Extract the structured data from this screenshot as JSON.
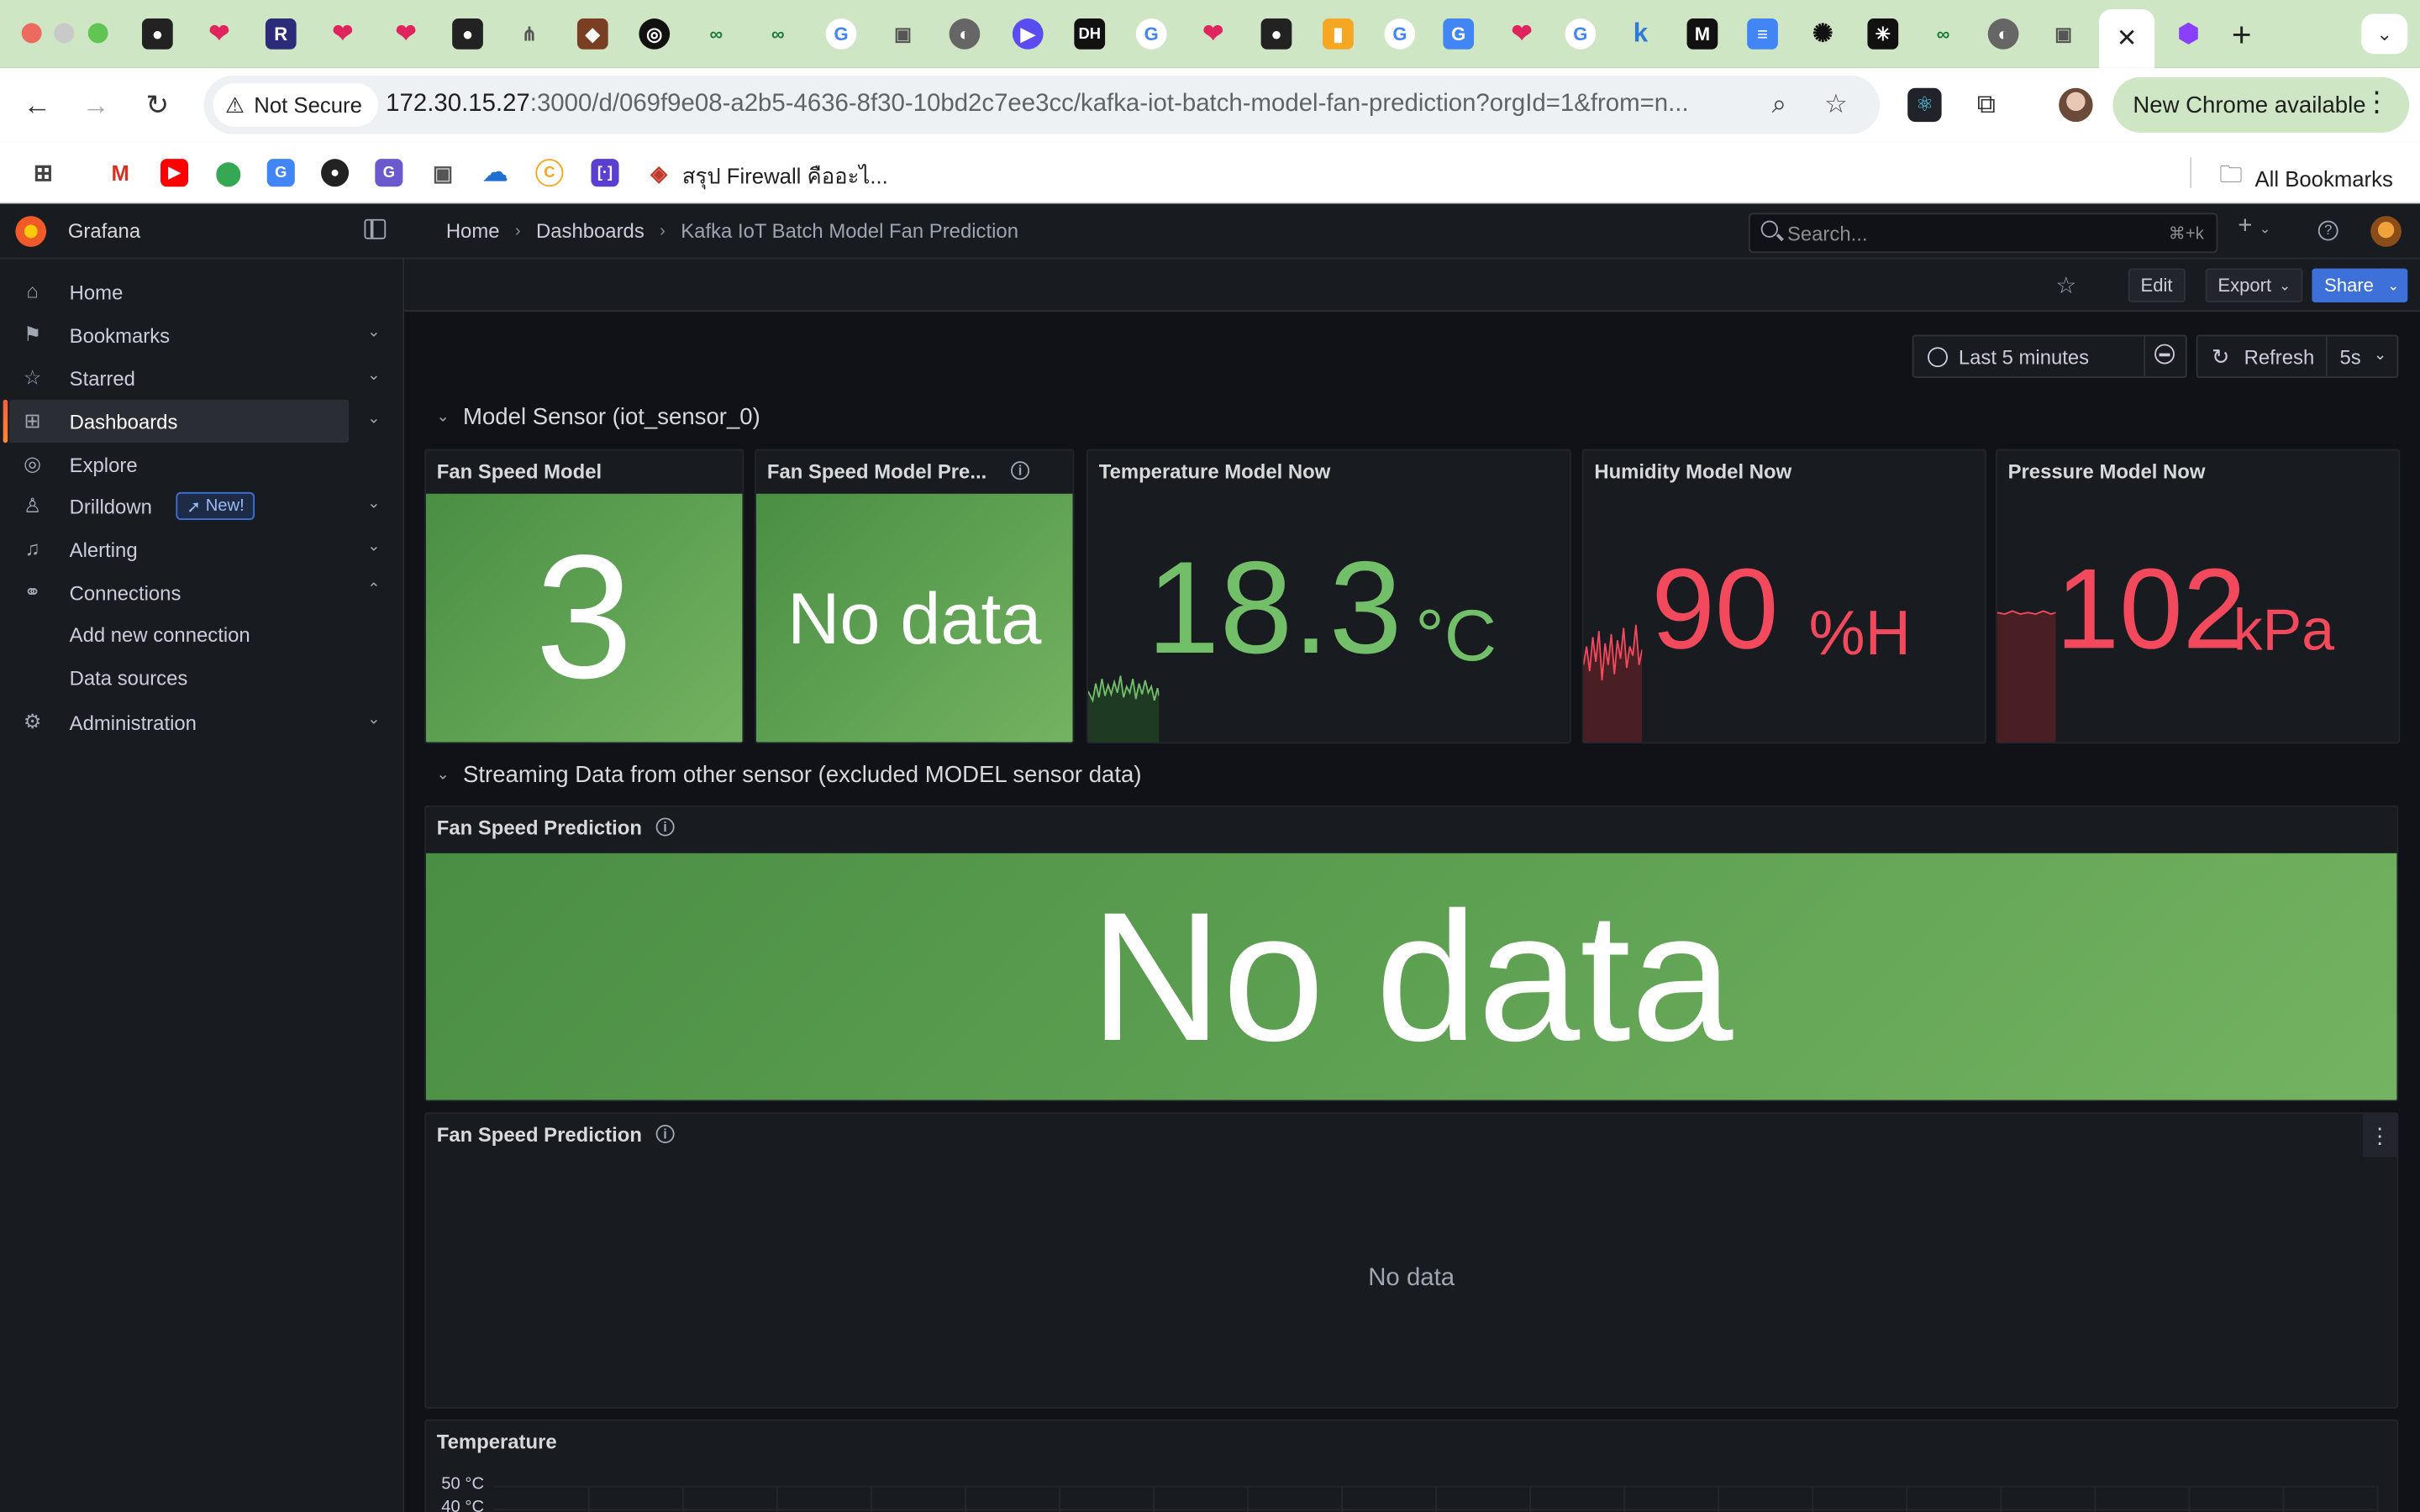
{
  "browser": {
    "url_host": "172.30.15.27",
    "url_rest": ":3000/d/069f9e08-a2b5-4636-8f30-10bd2c7ee3cc/kafka-iot-batch-model-fan-prediction?orgId=1&from=n...",
    "not_secure_label": "Not Secure",
    "update_label": "New Chrome available",
    "bookmark_text": "สรุป Firewall คืออะไ...",
    "all_bookmarks_label": "All Bookmarks"
  },
  "grafana": {
    "brand": "Grafana",
    "search_placeholder": "Search...",
    "search_shortcut": "⌘+k",
    "breadcrumb": [
      "Home",
      "Dashboards",
      "Kafka IoT Batch Model Fan Prediction"
    ],
    "toolbar": {
      "edit": "Edit",
      "export": "Export",
      "share": "Share"
    },
    "time_range": "Last 5 minutes",
    "refresh_label": "Refresh",
    "refresh_interval": "5s"
  },
  "sidebar": {
    "items": [
      {
        "label": "Home",
        "icon": "home-icon"
      },
      {
        "label": "Bookmarks",
        "icon": "bookmark-icon"
      },
      {
        "label": "Starred",
        "icon": "star-icon"
      },
      {
        "label": "Dashboards",
        "icon": "apps-icon"
      },
      {
        "label": "Explore",
        "icon": "compass-icon"
      },
      {
        "label": "Drilldown",
        "icon": "drilldown-icon"
      },
      {
        "label": "Alerting",
        "icon": "bell-icon"
      },
      {
        "label": "Connections",
        "icon": "connections-icon"
      },
      {
        "label": "Administration",
        "icon": "cog-icon"
      }
    ],
    "sub_items": [
      "Add new connection",
      "Data sources"
    ],
    "new_badge": "New!"
  },
  "dashboard": {
    "row1_title": "Model Sensor (iot_sensor_0)",
    "row2_title": "Streaming Data from other sensor (excluded MODEL sensor data)",
    "panels": {
      "fan_speed_model": {
        "title": "Fan Speed Model",
        "value": "3"
      },
      "fan_speed_model_pred": {
        "title": "Fan Speed Model Pre...",
        "value": "No data"
      },
      "temperature_now": {
        "title": "Temperature Model Now",
        "value": "18.3",
        "unit": "°C",
        "color": "#73bf69"
      },
      "humidity_now": {
        "title": "Humidity Model Now",
        "value": "90",
        "unit": "%H",
        "color": "#f2495c"
      },
      "pressure_now": {
        "title": "Pressure Model Now",
        "value": "102",
        "unit": "kPa",
        "color": "#f2495c"
      },
      "fan_pred_stat": {
        "title": "Fan Speed Prediction",
        "value": "No data"
      },
      "fan_pred_ts": {
        "title": "Fan Speed Prediction",
        "value": "No data"
      },
      "temperature_ts": {
        "title": "Temperature",
        "y_ticks": [
          "50 °C",
          "40 °C"
        ]
      }
    }
  }
}
